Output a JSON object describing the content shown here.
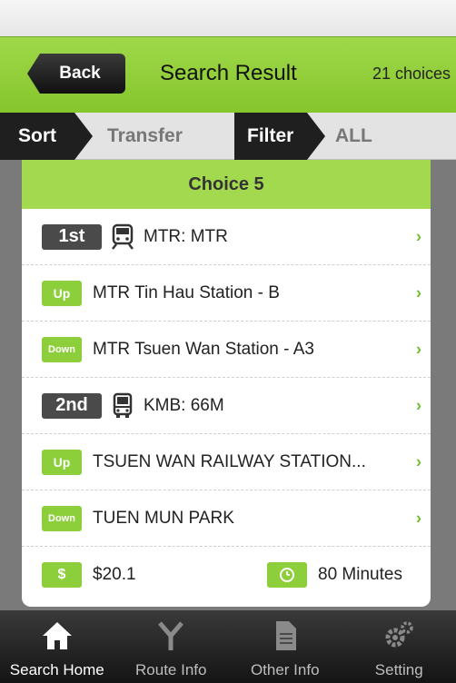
{
  "header": {
    "back_label": "Back",
    "title": "Search Result",
    "choices": "21 choices"
  },
  "sort_bar": {
    "sort_label": "Sort",
    "sort_value": "Transfer",
    "filter_label": "Filter",
    "filter_value": "ALL"
  },
  "card": {
    "title": "Choice 5",
    "rows": [
      {
        "badge": "1st",
        "icon": "train-icon",
        "text": "MTR: MTR"
      },
      {
        "badge": "Up",
        "text": "MTR Tin Hau Station - B"
      },
      {
        "badge": "Down",
        "text": "MTR Tsuen Wan Station - A3"
      },
      {
        "badge": "2nd",
        "icon": "bus-icon",
        "text": "KMB: 66M"
      },
      {
        "badge": "Up",
        "text": "TSUEN WAN RAILWAY STATION..."
      },
      {
        "badge": "Down",
        "text": "TUEN MUN PARK"
      }
    ],
    "fare_badge": "$",
    "fare": "$20.1",
    "duration": "80 Minutes"
  },
  "tabs": [
    {
      "label": "Search Home",
      "icon": "home-icon",
      "active": true
    },
    {
      "label": "Route Info",
      "icon": "route-fork-icon",
      "active": false
    },
    {
      "label": "Other Info",
      "icon": "document-icon",
      "active": false
    },
    {
      "label": "Setting",
      "icon": "gear-icon",
      "active": false
    }
  ],
  "colors": {
    "accent_green": "#8ccf3a",
    "header_green": "#9fd94a",
    "dark": "#1f1f1f"
  }
}
